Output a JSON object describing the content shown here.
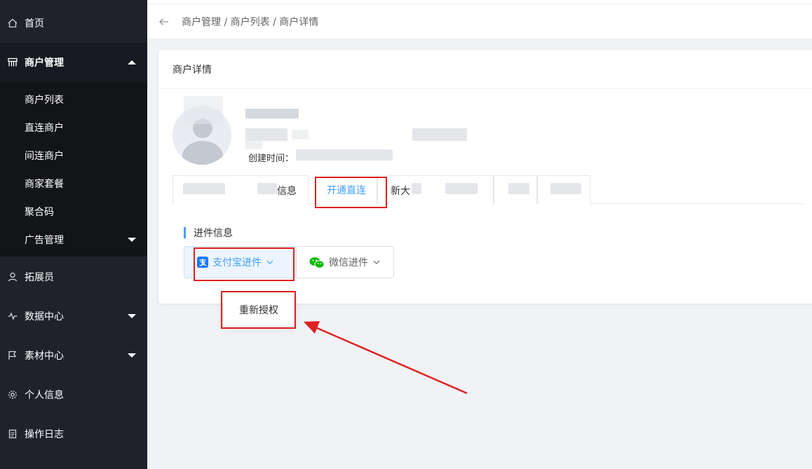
{
  "sidebar": {
    "items": [
      {
        "label": "首页",
        "icon": "home-icon"
      },
      {
        "label": "商户管理",
        "icon": "merchant-icon"
      },
      {
        "label": "拓展员",
        "icon": "user-icon"
      },
      {
        "label": "数据中心",
        "icon": "pulse-icon"
      },
      {
        "label": "素材中心",
        "icon": "flag-icon"
      },
      {
        "label": "个人信息",
        "icon": "gear-icon"
      },
      {
        "label": "操作日志",
        "icon": "log-icon"
      }
    ],
    "submenu": [
      "商户列表",
      "直连商户",
      "间连商户",
      "商家套餐",
      "聚合码",
      "广告管理"
    ]
  },
  "breadcrumb": {
    "text": "商户管理 / 商户列表 / 商户详情"
  },
  "card": {
    "title": "商户详情",
    "created_prefix": "创建时间："
  },
  "tabs": [
    "信息",
    "开通直连",
    "新大"
  ],
  "section": {
    "title": "进件信息"
  },
  "buttons": {
    "alipay": "支付宝进件",
    "wechat": "微信进件"
  },
  "dropdown": {
    "item": "重新授权"
  },
  "colors": {
    "accent": "#409eff",
    "highlight": "#e02020",
    "sidebar_bg": "#1f2229",
    "alipay_blue": "#1677ff",
    "wechat_green": "#09bb07"
  }
}
